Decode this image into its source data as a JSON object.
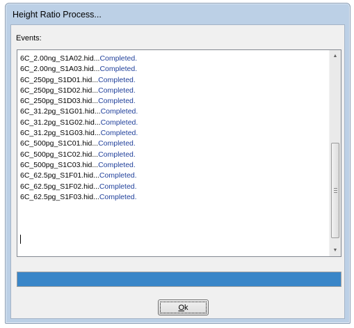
{
  "window": {
    "title": "Height Ratio Process..."
  },
  "events": {
    "label": "Events:",
    "lines": [
      {
        "file": "6C_2.00ng_S1A02.hid...",
        "status": "Completed."
      },
      {
        "file": "6C_2.00ng_S1A03.hid...",
        "status": "Completed."
      },
      {
        "file": "6C_250pg_S1D01.hid...",
        "status": "Completed."
      },
      {
        "file": "6C_250pg_S1D02.hid...",
        "status": "Completed."
      },
      {
        "file": "6C_250pg_S1D03.hid...",
        "status": "Completed."
      },
      {
        "file": "6C_31.2pg_S1G01.hid...",
        "status": "Completed."
      },
      {
        "file": "6C_31.2pg_S1G02.hid...",
        "status": "Completed."
      },
      {
        "file": "6C_31.2pg_S1G03.hid...",
        "status": "Completed."
      },
      {
        "file": "6C_500pg_S1C01.hid...",
        "status": "Completed."
      },
      {
        "file": "6C_500pg_S1C02.hid...",
        "status": "Completed."
      },
      {
        "file": "6C_500pg_S1C03.hid...",
        "status": "Completed."
      },
      {
        "file": "6C_62.5pg_S1F01.hid...",
        "status": "Completed."
      },
      {
        "file": "6C_62.5pg_S1F02.hid...",
        "status": "Completed."
      },
      {
        "file": "6C_62.5pg_S1F03.hid...",
        "status": "Completed."
      }
    ]
  },
  "progress": {
    "value_percent": 100,
    "color": "#3a86c8"
  },
  "ok_button": {
    "accel": "O",
    "rest": "k"
  },
  "icons": {
    "scroll_up": "up-arrow-icon",
    "scroll_down": "down-arrow-icon"
  },
  "colors": {
    "status_text": "#1f3f9a",
    "title_bar": "#bcd0e6"
  }
}
